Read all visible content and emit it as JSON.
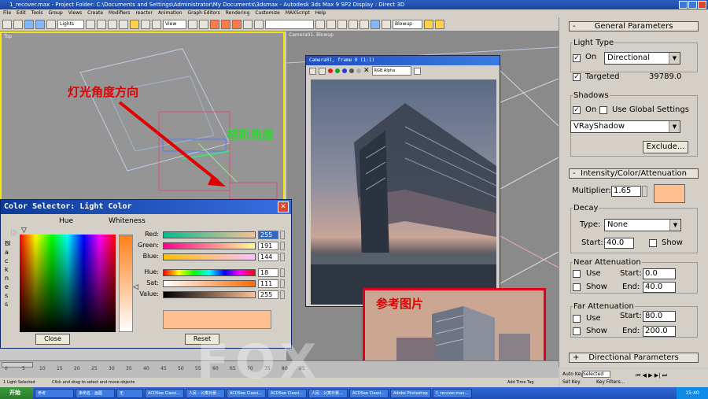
{
  "window": {
    "title": "1_recover.max    - Project Folder: C:\\Documents and Settings\\Administrator\\My Documents\\3dsmax    - Autodesk 3ds Max 9 SP2    Display : Direct 3D"
  },
  "menu": [
    "File",
    "Edit",
    "Tools",
    "Group",
    "Views",
    "Create",
    "Modifiers",
    "reactor",
    "Animation",
    "Graph Editors",
    "Rendering",
    "Customize",
    "MAXScript",
    "Help"
  ],
  "toolbar": {
    "selection_filter": "Lights",
    "ref_coord": "View",
    "named_selection": "Blowup"
  },
  "viewports": {
    "top_label": "Top",
    "camera_label": "Camera01, Blowup",
    "annotation_light": "灯光角度方向",
    "annotation_camera": "相机角度",
    "annotation_color_light": "#e00000",
    "annotation_color_camera": "#2bd92b"
  },
  "frame_window": {
    "title": "Camera01, frame 0 (1:1)",
    "channel": "RGB Alpha"
  },
  "color_selector": {
    "title": "Color Selector: Light Color",
    "hue_header": "Hue",
    "whiteness_header": "Whiteness",
    "blackness_label": "Blackness",
    "rows": [
      {
        "label": "Red:",
        "value": "255",
        "level": 1.0
      },
      {
        "label": "Green:",
        "value": "191",
        "level": 0.75
      },
      {
        "label": "Blue:",
        "value": "144",
        "level": 0.565
      },
      {
        "label": "Hue:",
        "value": "18",
        "level": 0.07
      },
      {
        "label": "Sat:",
        "value": "111",
        "level": 0.435
      },
      {
        "label": "Value:",
        "value": "255",
        "level": 1.0
      }
    ],
    "swatch_color": "#ffbf90",
    "close_label": "Close",
    "reset_label": "Reset"
  },
  "ref_image": {
    "caption": "参考图片"
  },
  "panel": {
    "general_rollout": "General Parameters",
    "light_type_group": "Light Type",
    "on_label": "On",
    "light_type_value": "Directional",
    "targeted_label": "Targeted",
    "targeted_value": "39789.0",
    "shadows_group": "Shadows",
    "shadows_on_label": "On",
    "use_global_label": "Use Global Settings",
    "shadow_type": "VRayShadow",
    "exclude_button": "Exclude...",
    "intensity_rollout": "Intensity/Color/Attenuation",
    "multiplier_label": "Multiplier:",
    "multiplier_value": "1.65",
    "multiplier_color": "#ffbf90",
    "decay_group": "Decay",
    "decay_type_label": "Type:",
    "decay_type_value": "None",
    "decay_start_label": "Start:",
    "decay_start_value": "40.0",
    "show_label": "Show",
    "near_group": "Near Attenuation",
    "use_label": "Use",
    "start_label": "Start:",
    "end_label": "End:",
    "near_start": "0.0",
    "near_end": "40.0",
    "far_group": "Far Attenuation",
    "far_start": "80.0",
    "far_end": "200.0",
    "directional_rollout": "Directional Parameters"
  },
  "timeline": {
    "ticks": [
      "0",
      "5",
      "10",
      "15",
      "20",
      "25",
      "30",
      "35",
      "40",
      "45",
      "50",
      "55",
      "60",
      "65",
      "70",
      "75",
      "80",
      "85"
    ],
    "status_top": "1 Light Selected",
    "status_bottom": "Click and drag to select and move objects",
    "add_time_tag": "Add Time Tag",
    "auto_key": "Auto Key",
    "set_key": "Set Key",
    "selected": "Selected",
    "key_filters": "Key Filters..."
  },
  "taskbar": {
    "start": "开始",
    "tasks": [
      "参考",
      "未命名 - 画图",
      "无",
      "ACDSee Classi...",
      "人民 - 公寓日景...",
      "ACDSee Classi...",
      "ACDSee Classi...",
      "人民 - 公寓日景...",
      "ACDSee Classi...",
      "Adobe Photoshop",
      "1_recover.max..."
    ],
    "clock": "15:40"
  },
  "watermark": "FOX"
}
